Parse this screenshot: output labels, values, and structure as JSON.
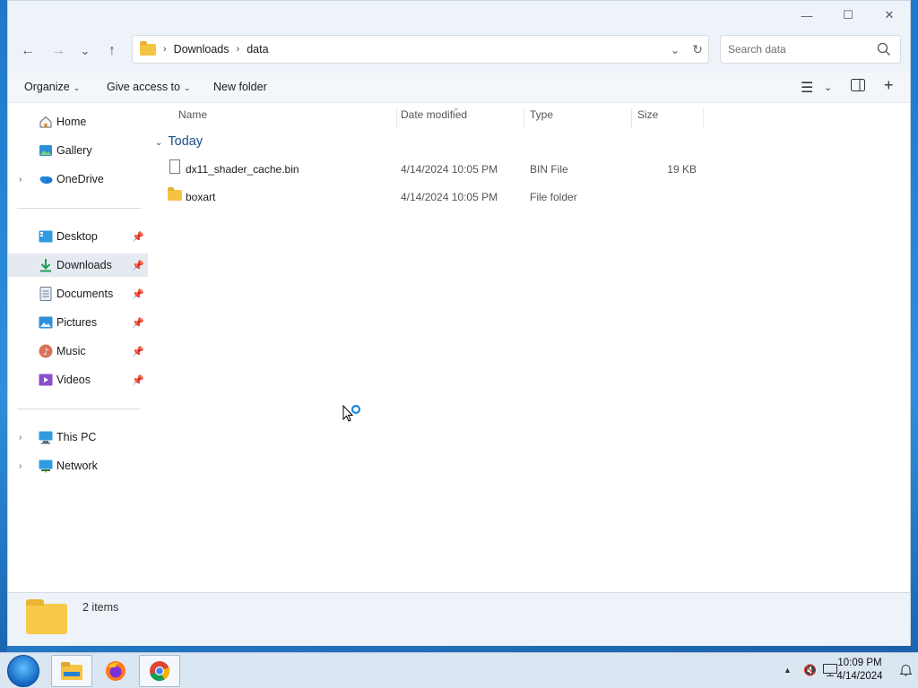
{
  "window": {
    "controls": {
      "minimize": "—",
      "maximize": "☐",
      "close": "✕"
    }
  },
  "nav": {
    "back": "←",
    "forward": "→",
    "recent": "⌄",
    "up": "↑",
    "breadcrumb": [
      "Downloads",
      "data"
    ],
    "search_placeholder": "Search data"
  },
  "commands": {
    "organize": "Organize",
    "give_access": "Give access to",
    "new_folder": "New folder"
  },
  "sidebar": {
    "quick": [
      {
        "label": "Home"
      },
      {
        "label": "Gallery"
      },
      {
        "label": "OneDrive"
      }
    ],
    "pinned": [
      {
        "label": "Desktop"
      },
      {
        "label": "Downloads"
      },
      {
        "label": "Documents"
      },
      {
        "label": "Pictures"
      },
      {
        "label": "Music"
      },
      {
        "label": "Videos"
      }
    ],
    "devices": [
      {
        "label": "This PC"
      },
      {
        "label": "Network"
      }
    ]
  },
  "columns": {
    "name": "Name",
    "date": "Date modified",
    "type": "Type",
    "size": "Size"
  },
  "group": {
    "label": "Today"
  },
  "files": [
    {
      "name": "dx11_shader_cache.bin",
      "date": "4/14/2024 10:05 PM",
      "type": "BIN File",
      "size": "19 KB",
      "icon": "file-icon"
    },
    {
      "name": "boxart",
      "date": "4/14/2024 10:05 PM",
      "type": "File folder",
      "size": "",
      "icon": "folder-icon"
    }
  ],
  "status": {
    "items": "2 items"
  },
  "taskbar": {
    "time": "10:09 PM",
    "date": "4/14/2024"
  }
}
